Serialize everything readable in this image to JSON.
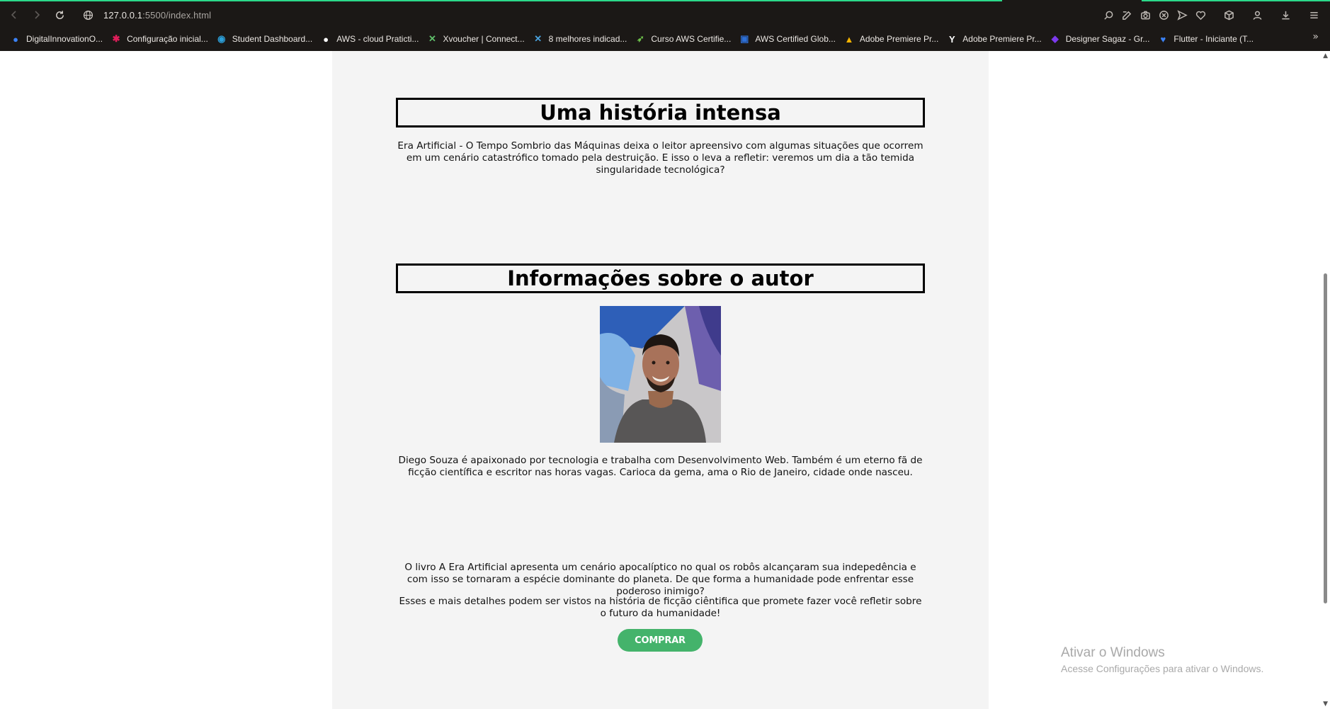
{
  "browser": {
    "url_host": "127.0.0.1",
    "url_rest": ":5500/index.html",
    "nav": {
      "back_icon": "arrow-left-icon",
      "forward_icon": "arrow-right-icon",
      "reload_icon": "reload-icon"
    },
    "toolbar_icons": [
      "find-icon",
      "edit-icon",
      "camera-icon",
      "adblock-icon",
      "send-icon",
      "heart-icon",
      "cube-icon",
      "profile-icon",
      "download-icon",
      "menu-icon"
    ],
    "accent": "#2bd98a"
  },
  "bookmarks": [
    {
      "label": "DigitalInnovationO...",
      "icon": "dio-icon",
      "color": "#3b82f6"
    },
    {
      "label": "Configuração inicial...",
      "icon": "slack-icon",
      "color": "#e01e5a"
    },
    {
      "label": "Student Dashboard...",
      "icon": "eye-icon",
      "color": "#2c9fd9"
    },
    {
      "label": "AWS - cloud Praticti...",
      "icon": "github-icon",
      "color": "#ffffff"
    },
    {
      "label": "Xvoucher | Connect...",
      "icon": "x-icon",
      "color": "#5fbf6a"
    },
    {
      "label": "8 melhores indicad...",
      "icon": "x-blue-icon",
      "color": "#4aa3df"
    },
    {
      "label": "Curso AWS Certifie...",
      "icon": "bird-icon",
      "color": "#6cc04a"
    },
    {
      "label": "AWS Certified Glob...",
      "icon": "card-icon",
      "color": "#2d6fd6"
    },
    {
      "label": "Adobe Premiere Pr...",
      "icon": "drive-icon",
      "color": "#f4b400"
    },
    {
      "label": "Adobe Premiere Pr...",
      "icon": "ya-icon",
      "color": "#ffffff"
    },
    {
      "label": "Designer Sagaz - Gr...",
      "icon": "designer-icon",
      "color": "#7c3aed"
    },
    {
      "label": "Flutter - Iniciante (T...",
      "icon": "heart-blue-icon",
      "color": "#3b82f6"
    }
  ],
  "page": {
    "story": {
      "title": "Uma história intensa",
      "text": "Era Artificial - O Tempo Sombrio das Máquinas deixa o leitor apreensivo com algumas situações que ocorrem em um cenário catastrófico tomado pela destruição. E isso o leva a refletir: veremos um dia a tão temida singularidade tecnológica?"
    },
    "author": {
      "title": "Informações sobre o autor",
      "photo_alt": "author-photo",
      "bio": "Diego Souza é apaixonado por tecnologia e trabalha com Desenvolvimento Web. Também é um eterno fã de ficção científica e escritor nas horas vagas. Carioca da gema, ama o Rio de Janeiro, cidade onde nasceu."
    },
    "book": {
      "p1": "O livro A Era Artificial apresenta um cenário apocalíptico no qual os robôs alcançaram sua indepedência e com isso se tornaram a espécie dominante do planeta. De que forma a humanidade pode enfrentar esse poderoso inimigo?",
      "p2": "Esses e mais detalhes podem ser vistos na história de ficção ciêntifica que promete fazer você refletir sobre o futuro da humanidade!",
      "buy_label": "COMPRAR",
      "buy_color": "#44b36b"
    }
  },
  "watermark": {
    "title": "Ativar o Windows",
    "subtitle": "Acesse Configurações para ativar o Windows."
  }
}
